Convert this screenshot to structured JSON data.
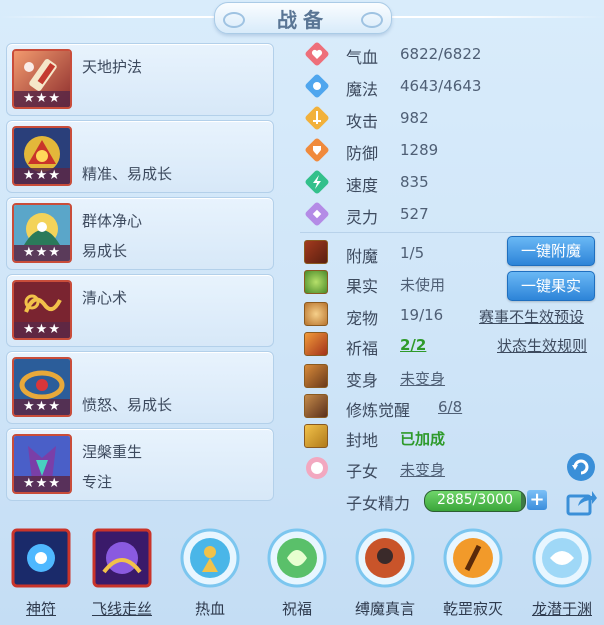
{
  "title": "战备",
  "skills": [
    {
      "name": "天地护法",
      "traits": "",
      "stars": "★★★"
    },
    {
      "name": "",
      "traits": "精准、易成长",
      "stars": "★★★"
    },
    {
      "name": "群体净心",
      "traits": "易成长",
      "stars": "★★★"
    },
    {
      "name": "清心术",
      "traits": "",
      "stars": "★★★"
    },
    {
      "name": "",
      "traits": "愤怒、易成长",
      "stars": "★★★"
    },
    {
      "name": "涅槃重生",
      "traits": "专注",
      "stars": "★★★"
    }
  ],
  "stats": [
    {
      "label": "气血",
      "value": "6822/6822",
      "icon": "heart-icon",
      "color": "#ee6f7a"
    },
    {
      "label": "魔法",
      "value": "4643/4643",
      "icon": "mana-drop-icon",
      "color": "#4fa6ee"
    },
    {
      "label": "攻击",
      "value": "982",
      "icon": "sword-icon",
      "color": "#f2b13a"
    },
    {
      "label": "防御",
      "value": "1289",
      "icon": "shield-icon",
      "color": "#f08a3c"
    },
    {
      "label": "速度",
      "value": "835",
      "icon": "lightning-icon",
      "color": "#33c08b"
    },
    {
      "label": "灵力",
      "value": "527",
      "icon": "spirit-icon",
      "color": "#b48be6"
    }
  ],
  "extras": [
    {
      "label": "附魔",
      "value": "1/5",
      "icon": "enchant-icon"
    },
    {
      "label": "果实",
      "value": "未使用",
      "icon": "fruit-icon"
    },
    {
      "label": "宠物",
      "value": "19/16",
      "icon": "pet-icon"
    },
    {
      "label": "祈福",
      "value": "2/2",
      "icon": "blessing-icon"
    },
    {
      "label": "变身",
      "value": "未变身",
      "icon": "transform-icon"
    },
    {
      "label": "修炼觉醒",
      "value": "6/8",
      "icon": "cultivation-icon"
    },
    {
      "label": "封地",
      "value": "已加成",
      "icon": "fief-icon"
    },
    {
      "label": "子女",
      "value": "未变身",
      "icon": "child-icon"
    }
  ],
  "buttons": {
    "enchant_all": "一键附魔",
    "fruit_all": "一键果实"
  },
  "links": {
    "contest_preset": "赛事不生效预设",
    "status_rules": "状态生效规则"
  },
  "child_energy": {
    "label": "子女精力",
    "value": "2885/3000",
    "fraction": 0.9617,
    "plus": "+"
  },
  "bottom_bar": [
    {
      "label": "神符",
      "icon": "divine-rune-icon"
    },
    {
      "label": "飞线走丝",
      "icon": "flying-thread-icon"
    },
    {
      "label": "热血",
      "icon": "hot-blood-icon"
    },
    {
      "label": "祝福",
      "icon": "blessing-orb-icon"
    },
    {
      "label": "缚魔真言",
      "icon": "bind-demon-icon"
    },
    {
      "label": "乾罡寂灭",
      "icon": "qiangang-icon"
    },
    {
      "label": "龙潜于渊",
      "icon": "dragon-abyss-icon"
    }
  ]
}
